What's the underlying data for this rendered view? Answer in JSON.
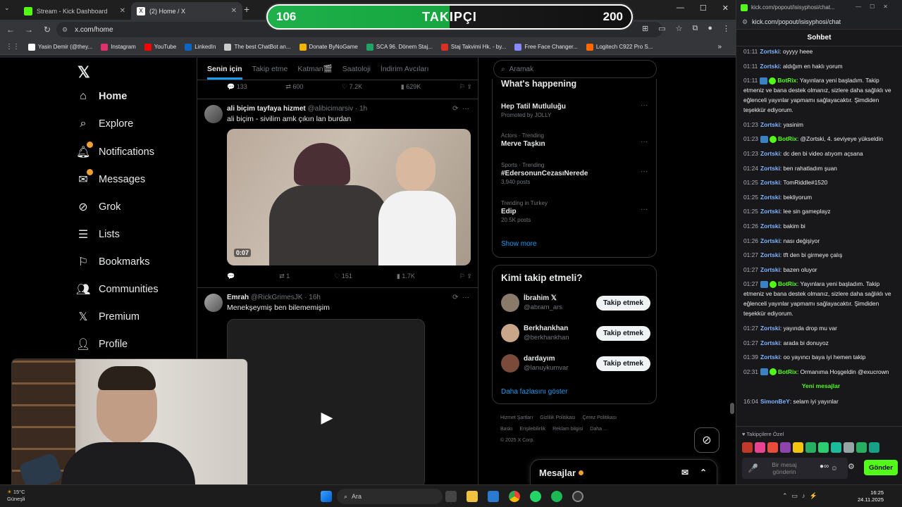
{
  "browser": {
    "tabs": [
      {
        "label": "Stream - Kick Dashboard",
        "icon_color": "#53fc18"
      },
      {
        "label": "(2) Home / X",
        "icon_color": "#ffffff"
      }
    ],
    "url": "x.com/home",
    "bookmarks": [
      {
        "label": "Yasin Demir (@they...",
        "color": "#ffffff"
      },
      {
        "label": "Instagram",
        "color": "#e1306c"
      },
      {
        "label": "YouTube",
        "color": "#ff0000"
      },
      {
        "label": "LinkedIn",
        "color": "#0a66c2"
      },
      {
        "label": "The best ChatBot an...",
        "color": "#cccccc"
      },
      {
        "label": "Donate ByNoGame",
        "color": "#f5b400"
      },
      {
        "label": "SCA 96. Dönem Staj...",
        "color": "#1fa463"
      },
      {
        "label": "Staj Takvimi Hk. - by...",
        "color": "#d93025"
      },
      {
        "label": "Free Face Changer...",
        "color": "#8888ff"
      },
      {
        "label": "Logitech C922 Pro S...",
        "color": "#ff6a00"
      }
    ]
  },
  "overlay": {
    "current": "106",
    "label": "TAKIPÇI",
    "goal": "200",
    "progress": 0.53
  },
  "nav": {
    "items": [
      {
        "label": "Home",
        "icon": "home-icon"
      },
      {
        "label": "Explore",
        "icon": "search-icon"
      },
      {
        "label": "Notifications",
        "icon": "bell-icon"
      },
      {
        "label": "Messages",
        "icon": "mail-icon"
      },
      {
        "label": "Grok",
        "icon": "grok-icon"
      },
      {
        "label": "Lists",
        "icon": "list-icon"
      },
      {
        "label": "Bookmarks",
        "icon": "bookmark-icon"
      },
      {
        "label": "Communities",
        "icon": "people-icon"
      },
      {
        "label": "Premium",
        "icon": "x-icon"
      },
      {
        "label": "Profile",
        "icon": "person-icon"
      }
    ]
  },
  "feed": {
    "tabs": [
      "Senin için",
      "Takip etme",
      "Katman🎬",
      "Saatoloji",
      "İndirim Avcıları"
    ],
    "prev_actions": {
      "replies": "133",
      "reposts": "600",
      "likes": "7.2K",
      "views": "629K"
    },
    "post1": {
      "name": "ali biçim tayfaya hizmet",
      "handle": "@alibicimarsiv · 1h",
      "text": "ali biçim - sivilim amk çıkın lan burdan",
      "duration": "0:07",
      "replies": "",
      "reposts": "1",
      "likes": "151",
      "views": "1.7K"
    },
    "post2": {
      "name": "Emrah",
      "handle": "@RickGrimesJK · 16h",
      "text": "Menekşeymiş ben bilememişim"
    }
  },
  "right": {
    "search_placeholder": "Aramak",
    "happening_title": "What's happening",
    "trends": [
      {
        "meta": "",
        "title": "Hep Tatil Mutluluğu",
        "count": "Promoted by JOLLY"
      },
      {
        "meta": "Actors · Trending",
        "title": "Merve Taşkın",
        "count": ""
      },
      {
        "meta": "Sports · Trending",
        "title": "#EdersonunCezasıNerede",
        "count": "3,940 posts"
      },
      {
        "meta": "Trending in Turkey",
        "title": "Edip",
        "count": "20.5K posts"
      }
    ],
    "show_more": "Show more",
    "who_title": "Kimi takip etmeli?",
    "who": [
      {
        "name": "İbrahim 𝕏",
        "handle": "@abram_ars",
        "btn": "Takip etmek"
      },
      {
        "name": "Berkhankhan",
        "handle": "@berkhankhan",
        "btn": "Takip etmek"
      },
      {
        "name": "dardayım",
        "handle": "@lanuykumvar",
        "btn": "Takip etmek"
      }
    ],
    "who_more": "Daha fazlasını göster",
    "footer": [
      "Hizmet Şartları",
      "Gizlilik Politikası",
      "Çerez Politikası",
      "Baskı",
      "Erişilebilirlik",
      "Reklam bilgisi",
      "Daha ...",
      "© 2025 X Corp."
    ]
  },
  "messages_bar": {
    "label": "Mesajlar"
  },
  "chat": {
    "tab_url": "kick.com/popout/isisyphosi/chat...",
    "url": "kick.com/popout/isisyphosi/chat",
    "title": "Sohbet",
    "messages": [
      {
        "t": "01:11",
        "u": "Zortski",
        "bot": false,
        "m": "oyyyy heee"
      },
      {
        "t": "01:11",
        "u": "Zortski",
        "bot": false,
        "m": "aldığım en haklı yorum"
      },
      {
        "t": "01:11",
        "u": "BotRix",
        "bot": true,
        "m": "Yayınlara yeni başladım. Takip etmeniz ve bana destek olmanız, sizlere daha sağlıklı ve eğlenceli yayınlar yapmamı sağlayacaktır. Şimdiden teşekkür ediyorum."
      },
      {
        "t": "01:23",
        "u": "Zortski",
        "bot": false,
        "m": "yasinim"
      },
      {
        "t": "01:23",
        "u": "BotRix",
        "bot": true,
        "m": "@Zortski, 4. seviyeye yükseldin"
      },
      {
        "t": "01:23",
        "u": "Zortski",
        "bot": false,
        "m": "dc den bi video atıyom açsana"
      },
      {
        "t": "01:24",
        "u": "Zortski",
        "bot": false,
        "m": "ben rahatladım şuan"
      },
      {
        "t": "01:25",
        "u": "Zortski",
        "bot": false,
        "m": "TomRiddle#1520"
      },
      {
        "t": "01:25",
        "u": "Zortski",
        "bot": false,
        "m": "bekliyorum"
      },
      {
        "t": "01:25",
        "u": "Zortski",
        "bot": false,
        "m": "lee sin gameplayz"
      },
      {
        "t": "01:26",
        "u": "Zortski",
        "bot": false,
        "m": "bakim bi"
      },
      {
        "t": "01:26",
        "u": "Zortski",
        "bot": false,
        "m": "nası değişiyor"
      },
      {
        "t": "01:27",
        "u": "Zortski",
        "bot": false,
        "m": "tft den bi girmeye çalış"
      },
      {
        "t": "01:27",
        "u": "Zortski",
        "bot": false,
        "m": "bazen oluyor"
      },
      {
        "t": "01:27",
        "u": "BotRix",
        "bot": true,
        "m": "Yayınlara yeni başladım. Takip etmeniz ve bana destek olmanız, sizlere daha sağlıklı ve eğlenceli yayınlar yapmamı sağlayacaktır. Şimdiden teşekkür ediyorum."
      },
      {
        "t": "01:27",
        "u": "Zortski",
        "bot": false,
        "m": "yayında drop mu var"
      },
      {
        "t": "01:27",
        "u": "Zortski",
        "bot": false,
        "m": "arada bi donuyoz"
      },
      {
        "t": "01:39",
        "u": "Zortski",
        "bot": false,
        "m": "oo yayıncı baya iyi hemen takip"
      },
      {
        "t": "02:31",
        "u": "BotRix",
        "bot": true,
        "m": "Ormanıma Hoşgeldin @exucrown"
      }
    ],
    "new_label": "Yeni mesajlar",
    "new_messages": [
      {
        "t": "16:04",
        "u": "SimonBeY",
        "bot": false,
        "m": "selam iyi yayınlar"
      }
    ],
    "followers_only": "Takipçilere Özel",
    "input_placeholder": "Bir mesaj gönderin",
    "send": "Gönder"
  },
  "taskbar": {
    "search": "Ara",
    "weather_temp": "15°C",
    "weather_label": "Güneşli",
    "time": "16:25",
    "date": "24.11.2025"
  }
}
